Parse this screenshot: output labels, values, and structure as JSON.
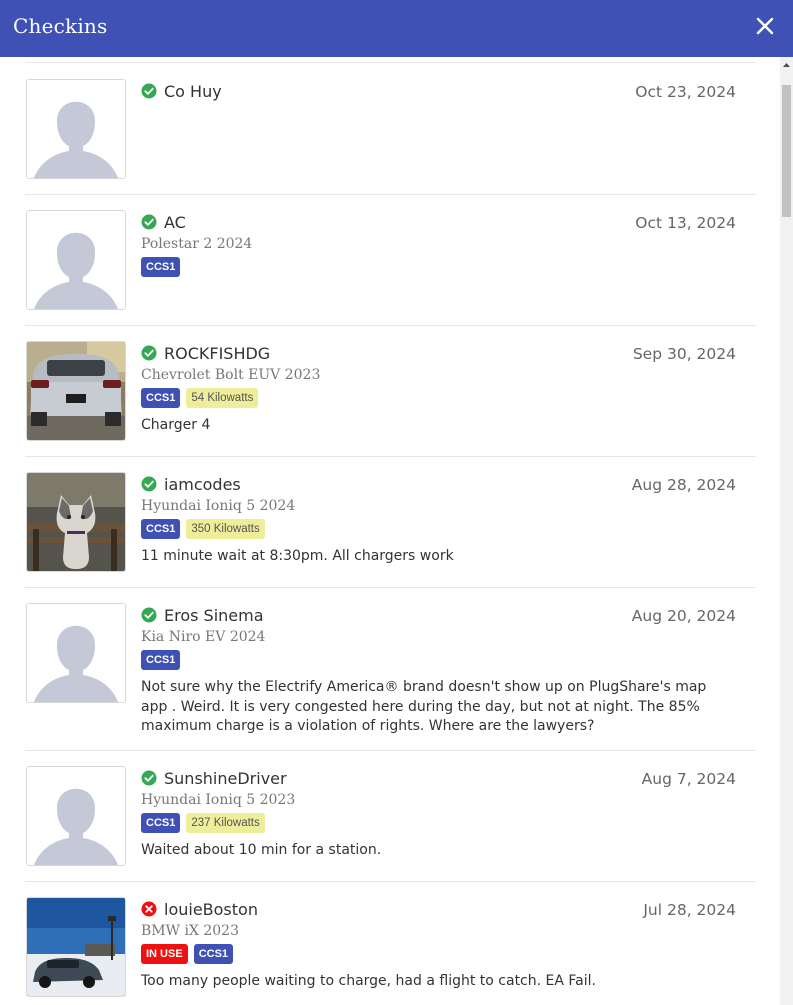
{
  "header": {
    "title": "Checkins"
  },
  "checkins": [
    {
      "name": "Co Huy",
      "date": "Oct 23, 2024",
      "vehicle": "",
      "status": "success",
      "badges": [],
      "comment": ""
    },
    {
      "name": "AC",
      "date": "Oct 13, 2024",
      "vehicle": "Polestar 2 2024",
      "status": "success",
      "badges": [
        "CCS1"
      ],
      "comment": ""
    },
    {
      "name": "ROCKFISHDG",
      "date": "Sep 30, 2024",
      "vehicle": "Chevrolet Bolt EUV 2023",
      "status": "success",
      "badges": [
        "CCS1",
        "54 Kilowatts"
      ],
      "comment": "Charger 4"
    },
    {
      "name": "iamcodes",
      "date": "Aug 28, 2024",
      "vehicle": "Hyundai Ioniq 5 2024",
      "status": "success",
      "badges": [
        "CCS1",
        "350 Kilowatts"
      ],
      "comment": "11 minute wait at 8:30pm. All chargers work"
    },
    {
      "name": "Eros Sinema",
      "date": "Aug 20, 2024",
      "vehicle": "Kia Niro EV 2024",
      "status": "success",
      "badges": [
        "CCS1"
      ],
      "comment": "Not sure why the Electrify America® brand doesn't show up on PlugShare's map app . Weird. It is very congested here during the day, but not at night. The 85% maximum charge is a violation of rights. Where are the lawyers?"
    },
    {
      "name": "SunshineDriver",
      "date": "Aug 7, 2024",
      "vehicle": "Hyundai Ioniq 5 2023",
      "status": "success",
      "badges": [
        "CCS1",
        "237 Kilowatts"
      ],
      "comment": "Waited about 10 min for a station."
    },
    {
      "name": "louieBoston",
      "date": "Jul 28, 2024",
      "vehicle": "BMW iX 2023",
      "status": "failure",
      "badges": [
        "IN USE",
        "CCS1"
      ],
      "comment": "Too many people waiting to charge, had a flight to catch. EA Fail."
    }
  ],
  "colors": {
    "header": "#3f51b5",
    "success": "#34a853",
    "failure": "#ee1111",
    "plug_badge": "#3f51b5",
    "kw_badge": "#eeee9a"
  }
}
